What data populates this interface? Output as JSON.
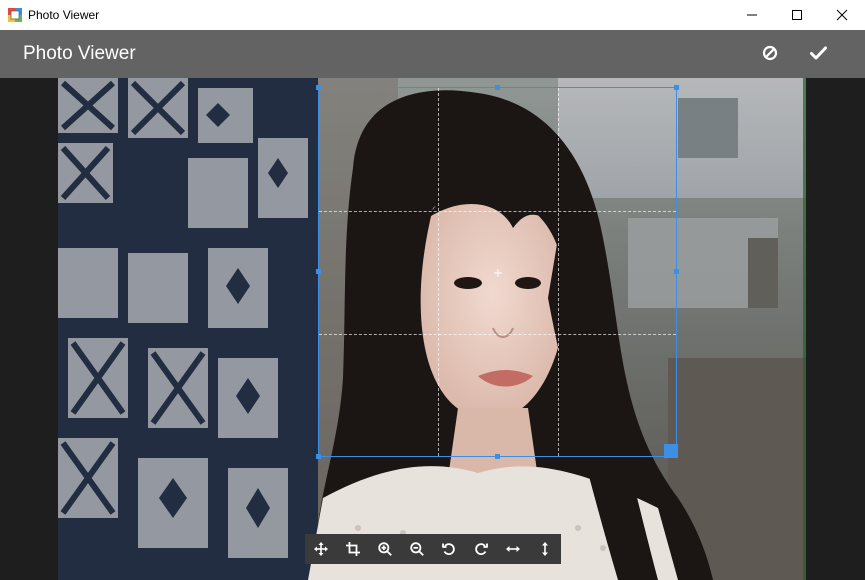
{
  "window": {
    "title": "Photo Viewer",
    "controls": [
      "minimize",
      "maximize",
      "close"
    ]
  },
  "header": {
    "title": "Photo Viewer",
    "actions": [
      {
        "name": "cancel",
        "icon": "ban-icon"
      },
      {
        "name": "confirm",
        "icon": "check-icon"
      }
    ]
  },
  "toolbar": {
    "tools": [
      {
        "name": "move",
        "icon": "move-icon"
      },
      {
        "name": "crop",
        "icon": "crop-icon"
      },
      {
        "name": "zoom-in",
        "icon": "zoom-in-icon"
      },
      {
        "name": "zoom-out",
        "icon": "zoom-out-icon"
      },
      {
        "name": "rotate-left",
        "icon": "rotate-left-icon"
      },
      {
        "name": "rotate-right",
        "icon": "rotate-right-icon"
      },
      {
        "name": "flip-horizontal",
        "icon": "flip-horizontal-icon"
      },
      {
        "name": "flip-vertical",
        "icon": "flip-vertical-icon"
      }
    ]
  },
  "colors": {
    "header_bg": "#636363",
    "stage_bg": "#1e1e1e",
    "crop_accent": "#3d8fe3",
    "toolbar_bg": "#3a3a3a"
  }
}
